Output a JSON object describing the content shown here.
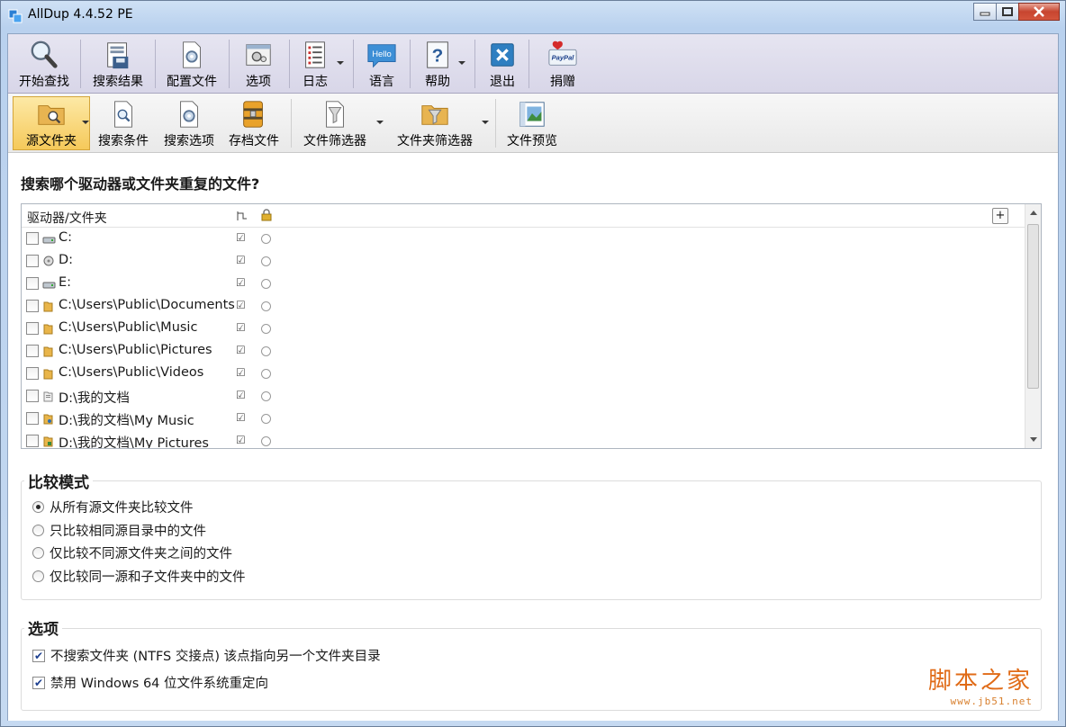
{
  "window": {
    "title": "AllDup 4.4.52 PE"
  },
  "toolbar_main": [
    {
      "label": "开始查找",
      "icon": "magnifier-icon"
    },
    {
      "label": "搜索结果",
      "icon": "save-results-icon"
    },
    {
      "label": "配置文件",
      "icon": "config-file-icon"
    },
    {
      "label": "选项",
      "icon": "options-icon"
    },
    {
      "label": "日志",
      "icon": "log-icon"
    },
    {
      "label": "语言",
      "icon": "language-hello-icon"
    },
    {
      "label": "帮助",
      "icon": "help-icon"
    },
    {
      "label": "退出",
      "icon": "exit-icon"
    },
    {
      "label": "捐赠",
      "icon": "paypal-donate-icon"
    }
  ],
  "toolbar_secondary": [
    {
      "label": "源文件夹",
      "icon": "source-folder-icon",
      "active": true
    },
    {
      "label": "搜索条件",
      "icon": "search-criteria-icon"
    },
    {
      "label": "搜索选项",
      "icon": "search-options-icon"
    },
    {
      "label": "存档文件",
      "icon": "archive-icon"
    },
    {
      "label": "文件筛选器",
      "icon": "file-filter-icon"
    },
    {
      "label": "文件夹筛选器",
      "icon": "folder-filter-icon"
    },
    {
      "label": "文件预览",
      "icon": "file-preview-icon"
    }
  ],
  "source": {
    "question": "搜索哪个驱动器或文件夹重复的文件?",
    "column_header": "驱动器/文件夹",
    "add_button": "+",
    "rows": [
      {
        "path": "C:",
        "icon": "drive-c-icon"
      },
      {
        "path": "D:",
        "icon": "drive-d-icon"
      },
      {
        "path": "E:",
        "icon": "drive-e-icon"
      },
      {
        "path": "C:\\Users\\Public\\Documents",
        "icon": "folder-icon"
      },
      {
        "path": "C:\\Users\\Public\\Music",
        "icon": "folder-icon"
      },
      {
        "path": "C:\\Users\\Public\\Pictures",
        "icon": "folder-icon"
      },
      {
        "path": "C:\\Users\\Public\\Videos",
        "icon": "folder-icon"
      },
      {
        "path": "D:\\我的文档",
        "icon": "documents-folder-icon"
      },
      {
        "path": "D:\\我的文档\\My Music",
        "icon": "music-folder-icon"
      },
      {
        "path": "D:\\我的文档\\My Pictures",
        "icon": "pictures-folder-icon"
      }
    ]
  },
  "compare_mode": {
    "title": "比较模式",
    "options": [
      {
        "label": "从所有源文件夹比较文件",
        "selected": true
      },
      {
        "label": "只比较相同源目录中的文件",
        "selected": false
      },
      {
        "label": "仅比较不同源文件夹之间的文件",
        "selected": false
      },
      {
        "label": "仅比较同一源和子文件夹中的文件",
        "selected": false
      }
    ]
  },
  "options": {
    "title": "选项",
    "items": [
      {
        "label": "不搜索文件夹 (NTFS 交接点) 该点指向另一个文件夹目录",
        "checked": true
      },
      {
        "label": "禁用 Windows 64 位文件系统重定向",
        "checked": true
      }
    ]
  },
  "watermark": {
    "big": "脚本之家",
    "small": "www.jb51.net"
  },
  "colors": {
    "accent": "#f5c95a",
    "titlebar": "#c5d9f1",
    "watermark": "#e06b17"
  }
}
